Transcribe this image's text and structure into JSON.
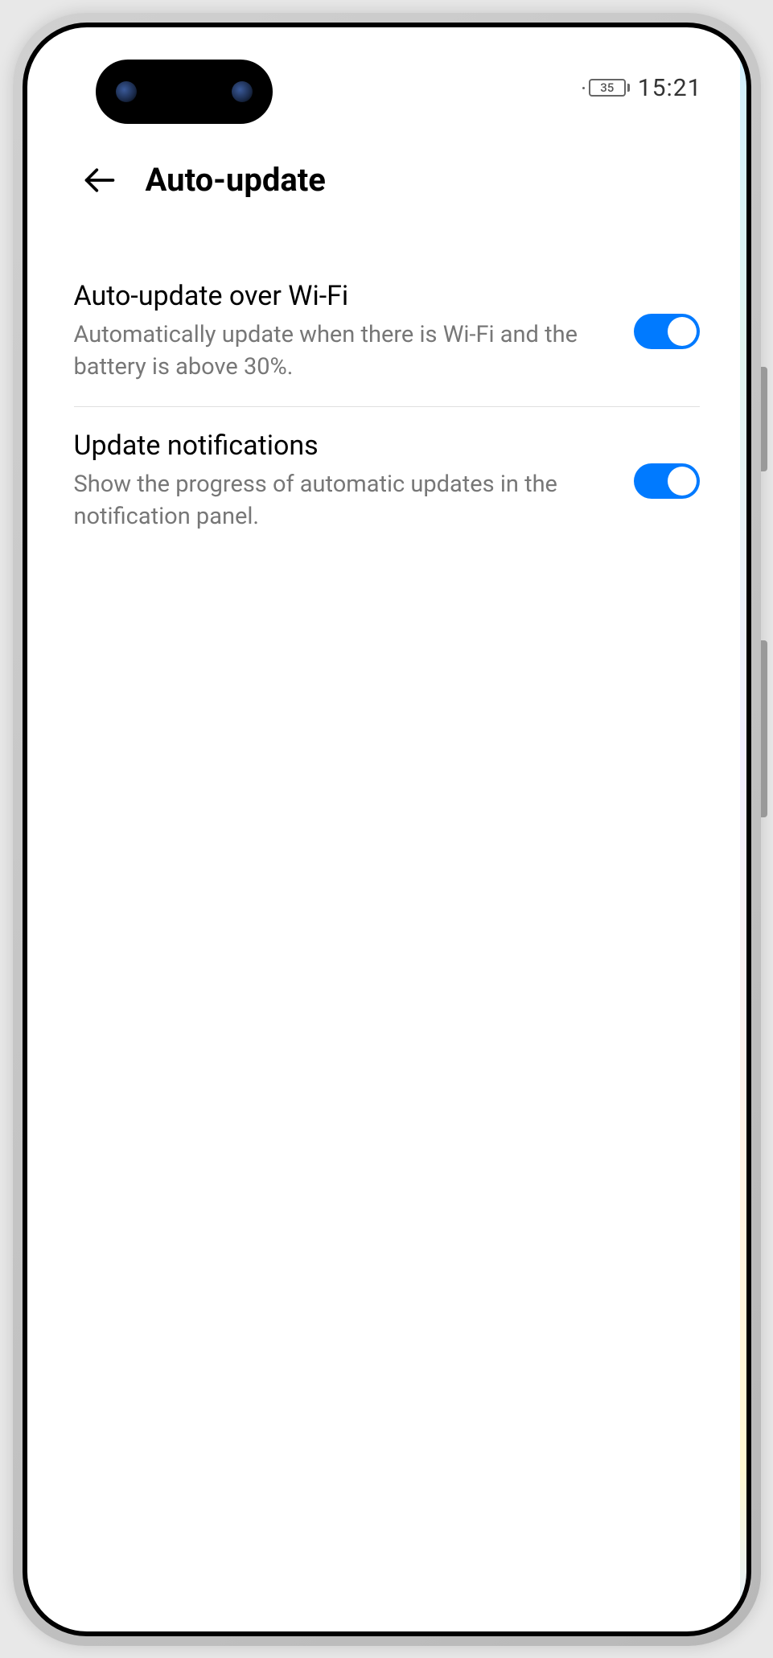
{
  "statusBar": {
    "battery": "35",
    "time": "15:21"
  },
  "header": {
    "title": "Auto-update"
  },
  "settings": [
    {
      "title": "Auto-update over Wi-Fi",
      "description": "Automatically update when there is Wi-Fi and the battery is above 30%.",
      "enabled": true
    },
    {
      "title": "Update notifications",
      "description": "Show the progress of automatic updates in the notification panel.",
      "enabled": true
    }
  ]
}
